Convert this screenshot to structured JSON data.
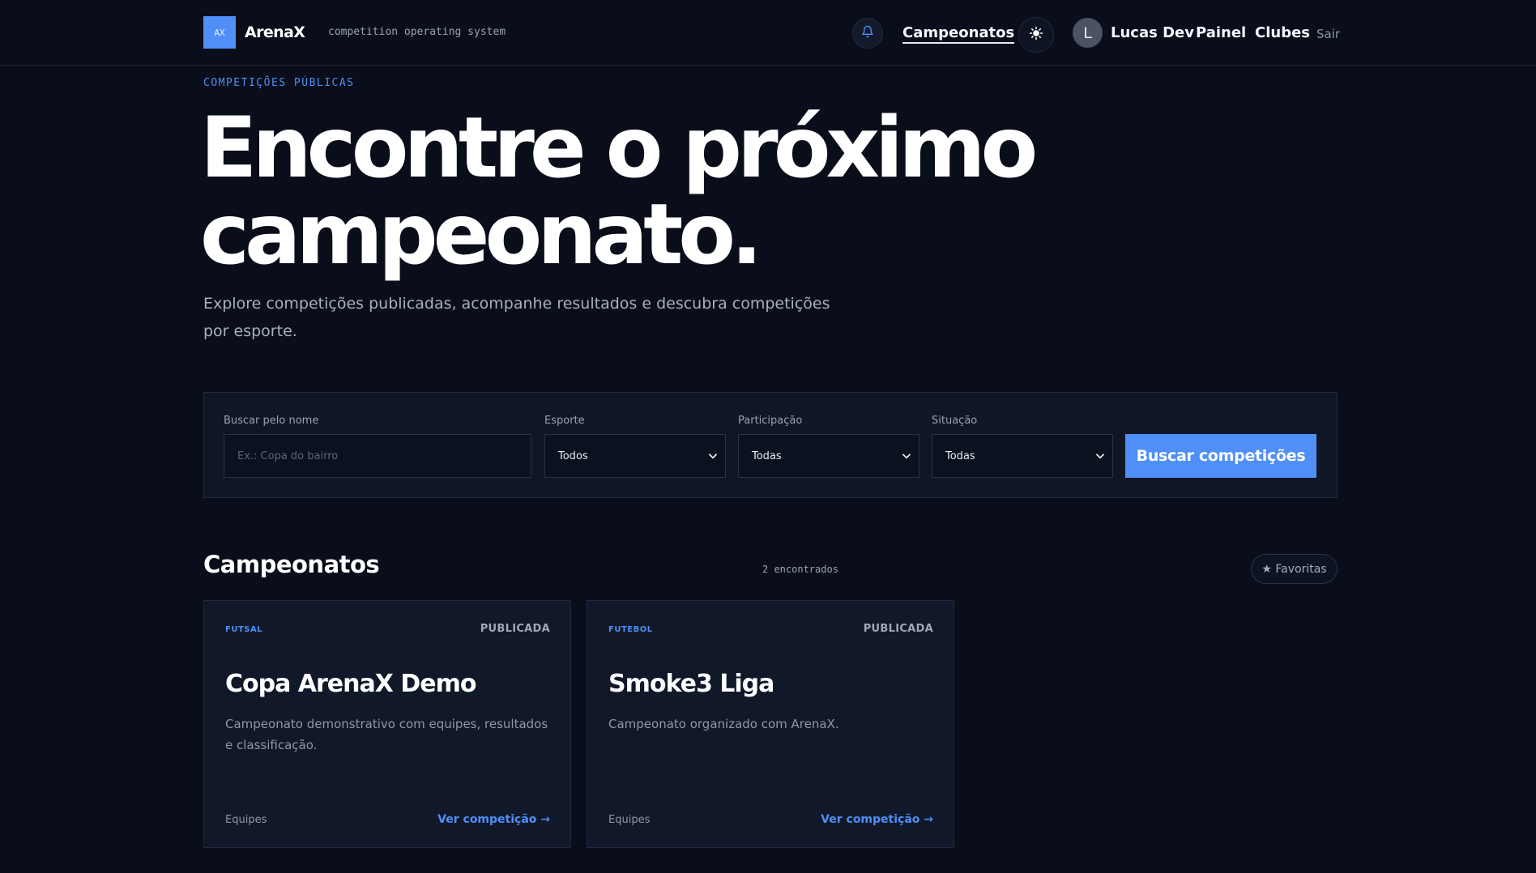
{
  "header": {
    "logo_text": "AX",
    "brand": "ArenaX",
    "tagline": "competition operating system",
    "nav_active": "Campeonatos",
    "user_initial": "L",
    "user_name": "Lucas Dev",
    "nav_painel": "Painel",
    "nav_clubes": "Clubes",
    "logout": "Sair",
    "icons": [
      "bell-icon",
      "sun-icon"
    ]
  },
  "hero": {
    "eyebrow": "COMPETIÇÕES PÚBLICAS",
    "title_line1": "Encontre o próximo",
    "title_line2": "campeonato.",
    "subtitle": "Explore competições publicadas, acompanhe resultados e descubra competições por esporte."
  },
  "search": {
    "name_label": "Buscar pelo nome",
    "name_placeholder": "Ex.: Copa do bairro",
    "sport_label": "Esporte",
    "sport_value": "Todos",
    "participation_label": "Participação",
    "participation_value": "Todas",
    "status_label": "Situação",
    "status_value": "Todas",
    "submit_label": "Buscar competições"
  },
  "list": {
    "title": "Campeonatos",
    "count": "2 encontrados",
    "favorites": "★ Favoritas",
    "cards": [
      {
        "sport": "FUTSAL",
        "status": "PUBLICADA",
        "title": "Copa ArenaX Demo",
        "description": "Campeonato demonstrativo com equipes, resultados e classificação.",
        "meta": "Equipes",
        "link": "Ver competição →"
      },
      {
        "sport": "FUTEBOL",
        "status": "PUBLICADA",
        "title": "Smoke3 Liga",
        "description": "Campeonato organizado com ArenaX.",
        "meta": "Equipes",
        "link": "Ver competição →"
      }
    ]
  },
  "colors": {
    "background": "#0a0e1a",
    "accent": "#4f8ff7",
    "card": "#101829"
  }
}
